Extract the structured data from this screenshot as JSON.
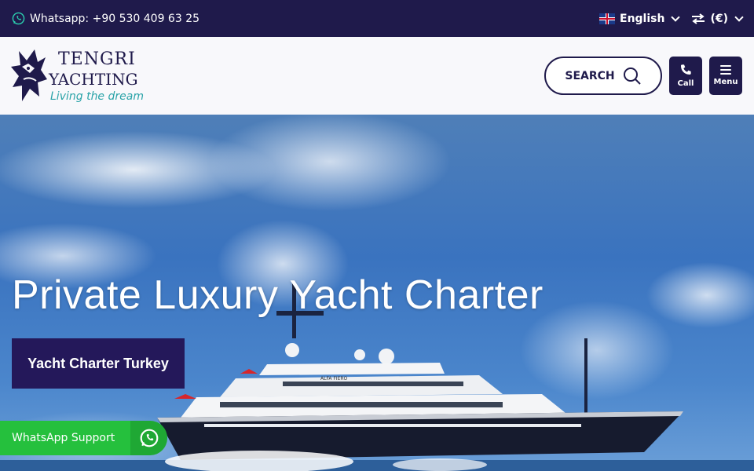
{
  "topbar": {
    "whatsapp_text": "Whatsapp: +90 530 409 63 25",
    "language": "English",
    "currency": "(€)",
    "icons": {
      "whatsapp": "whatsapp-icon",
      "flag": "uk-flag-icon",
      "swap": "swap-arrows-icon"
    }
  },
  "header": {
    "logo": {
      "line1": "TENGRI",
      "line2": "YACHTING",
      "tagline": "Living the dream"
    },
    "search_label": "SEARCH",
    "call_label": "Call",
    "menu_label": "Menu"
  },
  "hero": {
    "title": "Private Luxury Yacht Charter",
    "cta_label": "Yacht Charter Turkey",
    "yacht_name": "ALFA FIERO"
  },
  "whatsapp_support": {
    "label": "WhatsApp Support"
  },
  "colors": {
    "navy": "#1f1a4b",
    "teal": "#2aa3a8",
    "whatsapp_green": "#25c03d"
  }
}
